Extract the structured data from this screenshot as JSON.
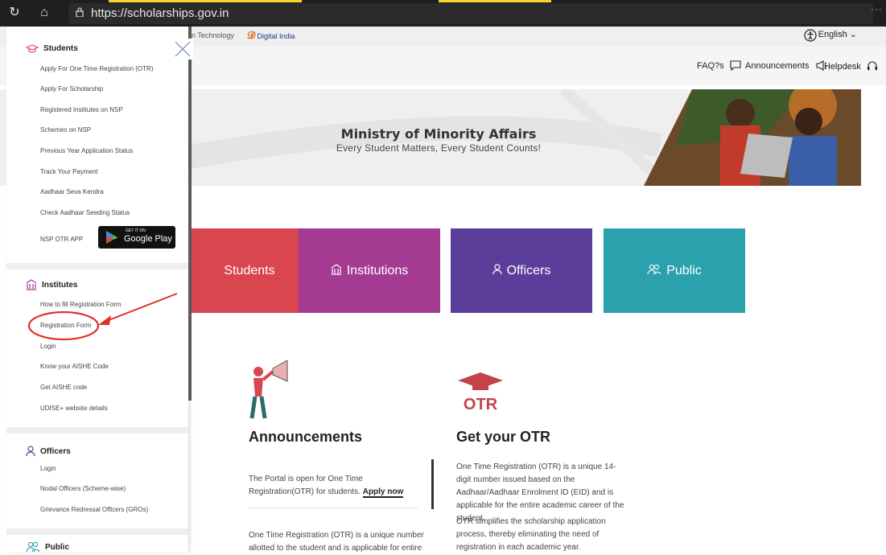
{
  "browser": {
    "url": "https://scholarships.gov.in",
    "reload_icon": "reload-icon",
    "home_icon": "home-icon"
  },
  "header": {
    "ministry_snippet": "n Technology",
    "digital_india": "Digital India",
    "language": "English",
    "faqs": "FAQ?s",
    "announcements": "Announcements",
    "helpdesk": "Helpdesk"
  },
  "hero": {
    "title": "Ministry of Minority Affairs",
    "subtitle": "Every Student Matters, Every Student Counts!"
  },
  "tiles": {
    "students": "Students",
    "institutions": "Institutions",
    "officers": "Officers",
    "public": "Public"
  },
  "announcements": {
    "title": "Announcements",
    "p1_text": "The Portal is open for One Time Registration(OTR) for students.",
    "p1_link": "Apply now",
    "p2": "One Time Registration (OTR) is a unique number allotted to the student and is applicable for entire"
  },
  "otr": {
    "title": "Get your OTR",
    "p1": "One Time Registration (OTR) is a unique 14-digit number issued based on the Aadhaar/Aadhaar Enrolment ID (EID) and is applicable for the entire academic career of the student.",
    "p2": "OTR simplifies the scholarship application process, thereby eliminating the need of registration in each academic year."
  },
  "drawer": {
    "students": {
      "heading": "Students",
      "items": [
        "Apply For One Time Registration (OTR)",
        "Apply For Scholarship",
        "Registered Institutes on NSP",
        "Schemes on NSP",
        "Previous Year Application Status",
        "Track Your Payment",
        "Aadhaar Seva Kendra",
        "Check Aadhaar Seeding Status",
        "NSP OTR APP"
      ],
      "gplay_small": "GET IT ON",
      "gplay_big": "Google Play"
    },
    "institutes": {
      "heading": "Institutes",
      "items": [
        "How to fill Registration Form",
        "Registration Form",
        "Login",
        "Know your AISHE Code",
        "Get AISHE code",
        "UDISE+ website details"
      ]
    },
    "officers": {
      "heading": "Officers",
      "items": [
        "Login",
        "Nodal Officers (Scheme-wise)",
        "Grievance Redressal Officers (GROs)"
      ]
    },
    "public": {
      "heading": "Public"
    }
  },
  "colors": {
    "students_tile": "#d9464f",
    "institutions_tile": "#a53a93",
    "officers_tile": "#5b3e9a",
    "public_tile": "#2aa1ad",
    "annotation": "#e0302a"
  }
}
